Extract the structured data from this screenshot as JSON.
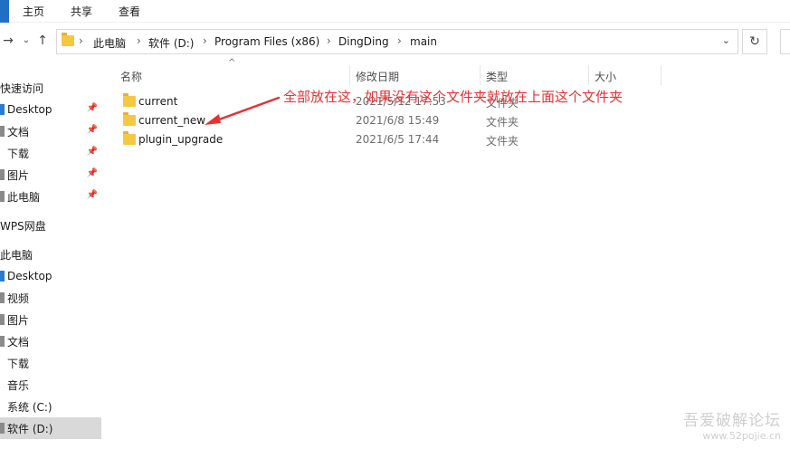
{
  "ribbon": {
    "tabs": [
      "主页",
      "共享",
      "查看"
    ]
  },
  "nav": {
    "back_icon": "arrow-left-icon",
    "forward_icon": "chevron-down-icon",
    "up_icon": "arrow-up-icon",
    "breadcrumb": [
      "此电脑",
      "软件 (D:)",
      "Program Files (x86)",
      "DingDing",
      "main"
    ],
    "dropdown_icon": "chevron-down-icon",
    "refresh_icon": "refresh-icon"
  },
  "sidebar": {
    "items": [
      {
        "label": "快速访问",
        "icon": "star-icon",
        "pinned": false
      },
      {
        "label": "Desktop",
        "icon": "desktop-icon",
        "pinned": true
      },
      {
        "label": "文档",
        "icon": "document-icon",
        "pinned": true
      },
      {
        "label": "下载",
        "icon": "download-icon",
        "pinned": true
      },
      {
        "label": "图片",
        "icon": "picture-icon",
        "pinned": true
      },
      {
        "label": "此电脑",
        "icon": "computer-icon",
        "pinned": true
      },
      {
        "label": "WPS网盘",
        "icon": "cloud-icon",
        "pinned": false
      },
      {
        "label": "此电脑",
        "icon": "computer-icon",
        "pinned": false
      },
      {
        "label": "Desktop",
        "icon": "desktop-icon",
        "pinned": false
      },
      {
        "label": "视频",
        "icon": "video-icon",
        "pinned": false
      },
      {
        "label": "图片",
        "icon": "picture-icon",
        "pinned": false
      },
      {
        "label": "文档",
        "icon": "document-icon",
        "pinned": false
      },
      {
        "label": "下载",
        "icon": "download-icon",
        "pinned": false
      },
      {
        "label": "音乐",
        "icon": "music-icon",
        "pinned": false
      },
      {
        "label": "系统 (C:)",
        "icon": "drive-icon",
        "pinned": false
      },
      {
        "label": "软件 (D:)",
        "icon": "drive-icon",
        "pinned": false,
        "selected": true
      }
    ]
  },
  "columns": {
    "name": "名称",
    "date": "修改日期",
    "type": "类型",
    "size": "大小"
  },
  "files": [
    {
      "name": "current",
      "date": "2021/5/12 17:53",
      "type": "文件夹"
    },
    {
      "name": "current_new",
      "date": "2021/6/8 15:49",
      "type": "文件夹"
    },
    {
      "name": "plugin_upgrade",
      "date": "2021/6/5 17:44",
      "type": "文件夹"
    }
  ],
  "annotation": {
    "text": "全部放在这，如果没有这个文件夹就放在上面这个文件夹",
    "color": "#e63232"
  },
  "watermark": {
    "line1": "吾爱破解论坛",
    "line2": "www.52pojie.cn"
  },
  "colors": {
    "accent": "#1f6fc5",
    "folder": "#f5c842",
    "selected": "#d9d9d9"
  }
}
